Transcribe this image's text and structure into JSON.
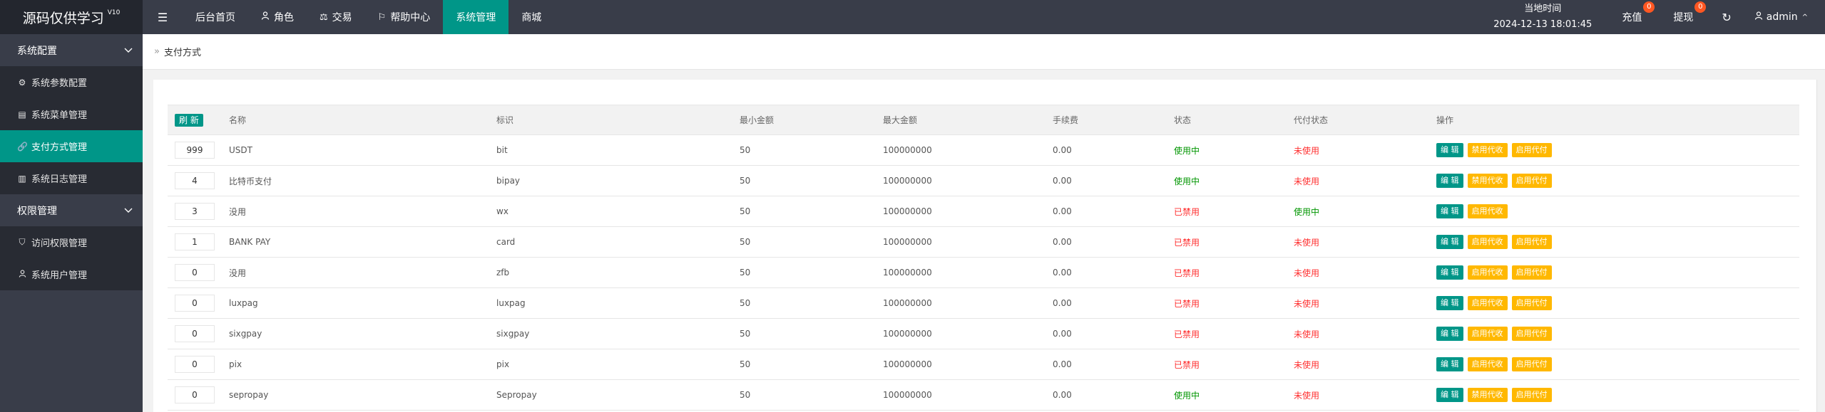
{
  "header": {
    "logo_text": "源码仅供学习",
    "logo_version": "V10",
    "menu_toggle_icon": "menu-icon",
    "nav": [
      {
        "label": "后台首页",
        "icon": ""
      },
      {
        "label": "角色",
        "icon": "user-icon"
      },
      {
        "label": "交易",
        "icon": "scale-icon"
      },
      {
        "label": "帮助中心",
        "icon": "flag-icon"
      },
      {
        "label": "系统管理",
        "icon": ""
      },
      {
        "label": "商城",
        "icon": ""
      }
    ],
    "active_nav": "系统管理",
    "clock_label": "当地时间",
    "clock_value": "2024-12-13 18:01:45",
    "recharge_label": "充值",
    "recharge_badge": "0",
    "withdraw_label": "提现",
    "withdraw_badge": "0",
    "user_name": "admin"
  },
  "sidebar": {
    "groups": [
      {
        "label": "系统配置"
      },
      {
        "label": "权限管理"
      }
    ],
    "items": [
      {
        "label": "系统参数配置",
        "icon": "gear-icon"
      },
      {
        "label": "系统菜单管理",
        "icon": "window-icon"
      },
      {
        "label": "支付方式管理",
        "icon": "link-icon"
      },
      {
        "label": "系统日志管理",
        "icon": "log-icon"
      },
      {
        "label": "访问权限管理",
        "icon": "shield-icon"
      },
      {
        "label": "系统用户管理",
        "icon": "user-icon"
      }
    ],
    "active_item": "支付方式管理"
  },
  "breadcrumb": {
    "current": "支付方式"
  },
  "table": {
    "refresh_label": "刷 新",
    "columns": [
      "名称",
      "标识",
      "最小金额",
      "最大金额",
      "手续费",
      "状态",
      "代付状态",
      "操作"
    ],
    "edit_label": "编 辑",
    "rows": [
      {
        "sort": "999",
        "name": "USDT",
        "code": "bit",
        "min": "50",
        "max": "100000000",
        "fee": "0.00",
        "status": "使用中",
        "status_on": true,
        "pay_status": "未使用",
        "pay_on": false,
        "btn1": "禁用代收",
        "btn2": "启用代付"
      },
      {
        "sort": "4",
        "name": "比特币支付",
        "code": "bipay",
        "min": "50",
        "max": "100000000",
        "fee": "0.00",
        "status": "使用中",
        "status_on": true,
        "pay_status": "未使用",
        "pay_on": false,
        "btn1": "禁用代收",
        "btn2": "启用代付"
      },
      {
        "sort": "3",
        "name": "没用",
        "code": "wx",
        "min": "50",
        "max": "100000000",
        "fee": "0.00",
        "status": "已禁用",
        "status_on": false,
        "pay_status": "使用中",
        "pay_on": true,
        "btn1": "启用代收",
        "btn2": ""
      },
      {
        "sort": "1",
        "name": "BANK PAY",
        "code": "card",
        "min": "50",
        "max": "100000000",
        "fee": "0.00",
        "status": "已禁用",
        "status_on": false,
        "pay_status": "未使用",
        "pay_on": false,
        "btn1": "启用代收",
        "btn2": "启用代付"
      },
      {
        "sort": "0",
        "name": "没用",
        "code": "zfb",
        "min": "50",
        "max": "100000000",
        "fee": "0.00",
        "status": "已禁用",
        "status_on": false,
        "pay_status": "未使用",
        "pay_on": false,
        "btn1": "启用代收",
        "btn2": "启用代付"
      },
      {
        "sort": "0",
        "name": "luxpag",
        "code": "luxpag",
        "min": "50",
        "max": "100000000",
        "fee": "0.00",
        "status": "已禁用",
        "status_on": false,
        "pay_status": "未使用",
        "pay_on": false,
        "btn1": "启用代收",
        "btn2": "启用代付"
      },
      {
        "sort": "0",
        "name": "sixgpay",
        "code": "sixgpay",
        "min": "50",
        "max": "100000000",
        "fee": "0.00",
        "status": "已禁用",
        "status_on": false,
        "pay_status": "未使用",
        "pay_on": false,
        "btn1": "启用代收",
        "btn2": "启用代付"
      },
      {
        "sort": "0",
        "name": "pix",
        "code": "pix",
        "min": "50",
        "max": "100000000",
        "fee": "0.00",
        "status": "已禁用",
        "status_on": false,
        "pay_status": "未使用",
        "pay_on": false,
        "btn1": "启用代收",
        "btn2": "启用代付"
      },
      {
        "sort": "0",
        "name": "sepropay",
        "code": "Sepropay",
        "min": "50",
        "max": "100000000",
        "fee": "0.00",
        "status": "使用中",
        "status_on": true,
        "pay_status": "未使用",
        "pay_on": false,
        "btn1": "禁用代收",
        "btn2": "启用代付"
      }
    ]
  },
  "colors": {
    "header_bg": "#393d49",
    "accent": "#009688",
    "warning": "#ffb800",
    "status_on": "#009600",
    "status_off": "#ff2f2f",
    "badge": "#ff5722"
  }
}
